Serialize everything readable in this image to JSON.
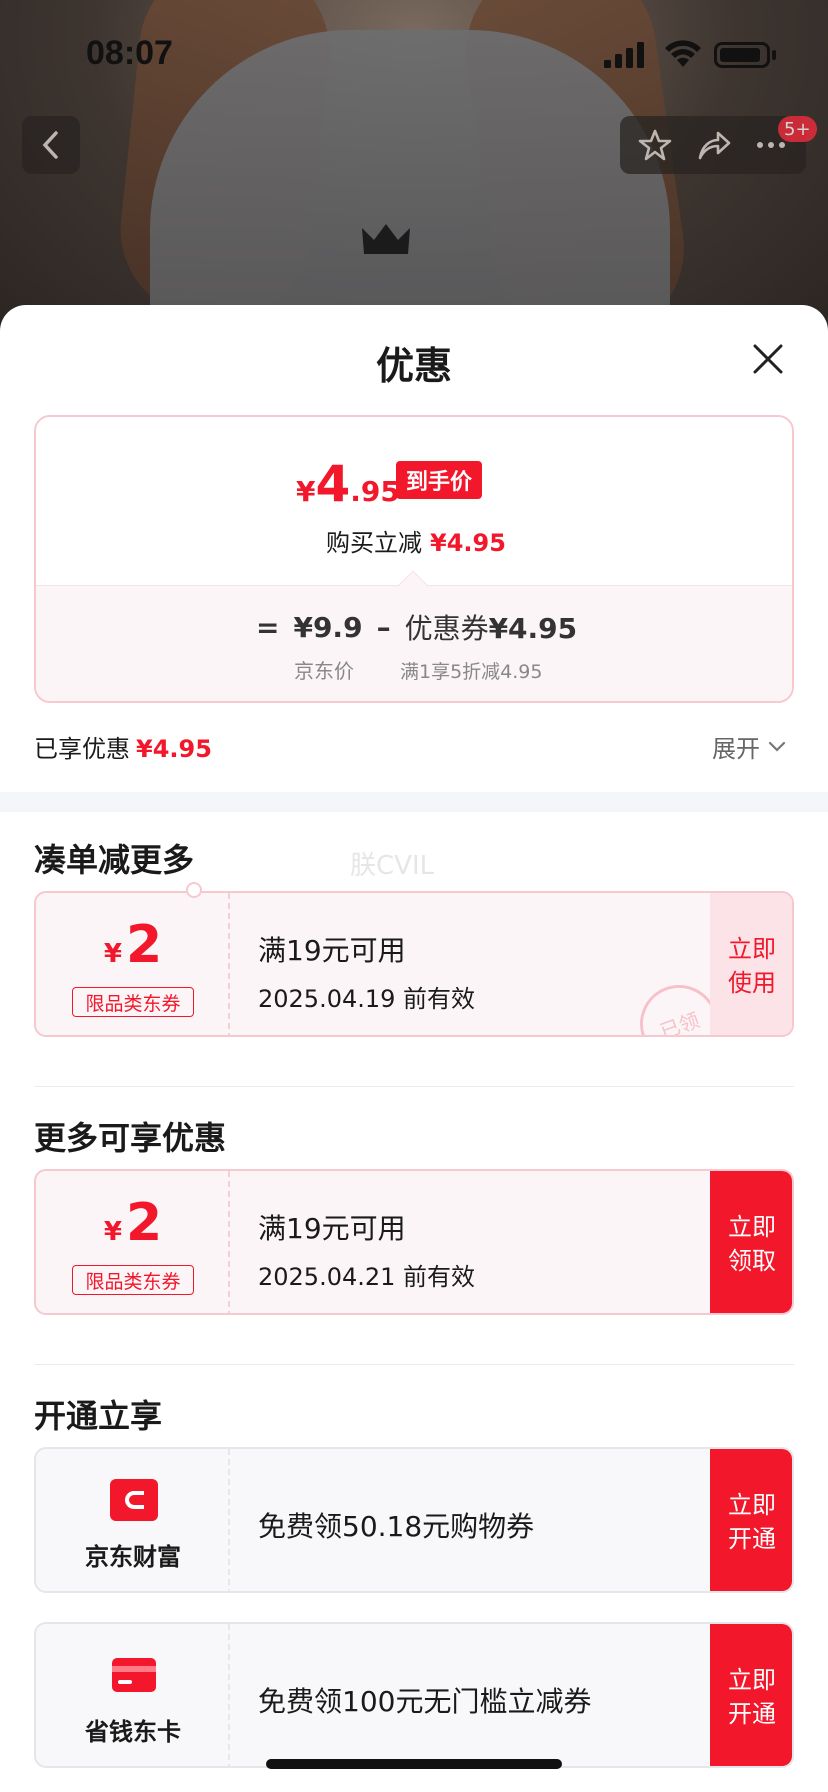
{
  "status_bar": {
    "time": "08:07"
  },
  "top_nav": {
    "badge": "5+"
  },
  "sheet": {
    "title": "优惠"
  },
  "price": {
    "yen": "¥",
    "int": "4",
    "dec": ".95",
    "tag": "到手价",
    "reduce_label": "购买立减",
    "reduce_value": "¥4.95",
    "eq": "=",
    "jd_price": "¥9.9",
    "minus": "–",
    "coupon_label": "优惠券",
    "coupon_value": "¥4.95",
    "jd_price_label": "京东价",
    "coupon_sub": "满1享5折减4.95"
  },
  "summary": {
    "enjoyed_label": "已享优惠",
    "enjoyed_value": "¥4.95",
    "expand": "展开"
  },
  "watermark": "朕CVIL",
  "sections": {
    "more_bundle": "凑单减更多",
    "more_offers": "更多可享优惠",
    "open_enjoy": "开通立享"
  },
  "coupons": [
    {
      "yen": "¥",
      "amount": "2",
      "tag": "限品类东券",
      "condition": "满19元可用",
      "expiry": "2025.04.19 前有效",
      "button": "立即\n使用",
      "stamp": "已领"
    },
    {
      "yen": "¥",
      "amount": "2",
      "tag": "限品类东券",
      "condition": "满19元可用",
      "expiry": "2025.04.21 前有效",
      "button": "立即\n领取"
    }
  ],
  "services": [
    {
      "name": "京东财富",
      "text": "免费领50.18元购物券",
      "button": "立即\n开通",
      "icon": "wallet-icon",
      "color": "#f2172b"
    },
    {
      "name": "省钱东卡",
      "text": "免费领100元无门槛立减券",
      "button": "立即\n开通",
      "icon": "card-icon",
      "color": "#f2172b"
    }
  ]
}
